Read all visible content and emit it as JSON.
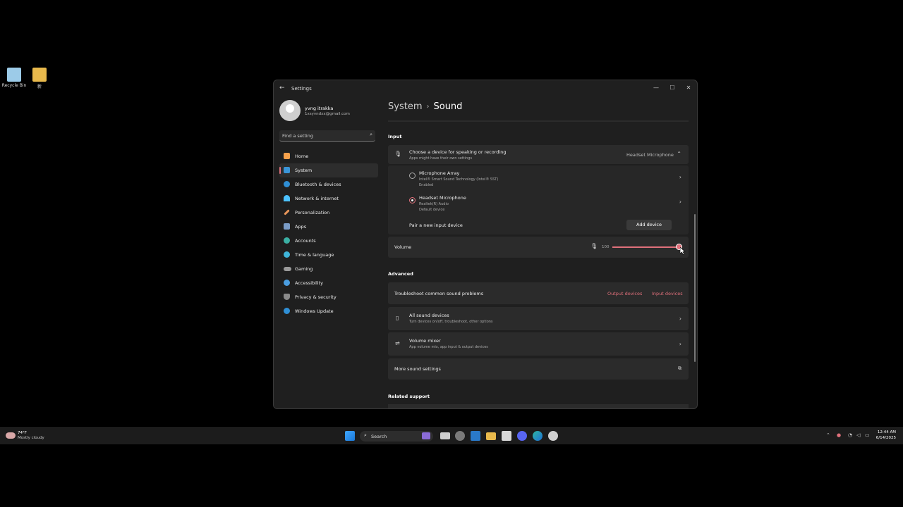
{
  "desktop": {
    "icons": [
      {
        "label": "Recycle Bin"
      },
      {
        "label": "新"
      }
    ]
  },
  "window": {
    "title": "Settings",
    "back_glyph": "←",
    "minimize_glyph": "—",
    "maximize_glyph": "☐",
    "close_glyph": "✕"
  },
  "profile": {
    "name": "yvng itrakka",
    "email": "1xsyvndxx@gmail.com"
  },
  "search": {
    "placeholder": "Find a setting",
    "icon_glyph": "⌕"
  },
  "nav": {
    "items": [
      {
        "label": "Home",
        "icon": "home-icon",
        "color": "#f6a14b"
      },
      {
        "label": "System",
        "icon": "system-icon",
        "color": "#3a95d8"
      },
      {
        "label": "Bluetooth & devices",
        "icon": "bluetooth-icon",
        "color": "#2f8fd5"
      },
      {
        "label": "Network & internet",
        "icon": "network-icon",
        "color": "#4cc2ff"
      },
      {
        "label": "Personalization",
        "icon": "brush-icon",
        "color": "#e8965a"
      },
      {
        "label": "Apps",
        "icon": "apps-icon",
        "color": "#7a9cc6"
      },
      {
        "label": "Accounts",
        "icon": "accounts-icon",
        "color": "#3bb0a4"
      },
      {
        "label": "Time & language",
        "icon": "globe-icon",
        "color": "#3fb5d9"
      },
      {
        "label": "Gaming",
        "icon": "gaming-icon",
        "color": "#9a9a9a"
      },
      {
        "label": "Accessibility",
        "icon": "accessibility-icon",
        "color": "#4a9de0"
      },
      {
        "label": "Privacy & security",
        "icon": "shield-icon",
        "color": "#8a8a8a"
      },
      {
        "label": "Windows Update",
        "icon": "update-icon",
        "color": "#2f8fd5"
      }
    ],
    "active_index": 1
  },
  "breadcrumb": {
    "parent": "System",
    "separator": "›",
    "current": "Sound"
  },
  "input_section": {
    "heading": "Input",
    "choose": {
      "title": "Choose a device for speaking or recording",
      "subtitle": "Apps might have their own settings",
      "selected": "Headset Microphone",
      "chevron": "⌃"
    },
    "devices": [
      {
        "name": "Microphone Array",
        "line1": "Intel® Smart Sound Technology (Intel® SST)",
        "line2": "Enabled",
        "selected": false
      },
      {
        "name": "Headset Microphone",
        "line1": "Realtek(R) Audio",
        "line2": "Default device",
        "selected": true
      }
    ],
    "pair": {
      "label": "Pair a new input device",
      "button": "Add device"
    },
    "volume": {
      "label": "Volume",
      "value": "100",
      "level": 1.0
    }
  },
  "advanced_section": {
    "heading": "Advanced",
    "troubleshoot": {
      "label": "Troubleshoot common sound problems",
      "link1": "Output devices",
      "link2": "Input devices"
    },
    "all_devices": {
      "title": "All sound devices",
      "subtitle": "Turn devices on/off, troubleshoot, other options"
    },
    "mixer": {
      "title": "Volume mixer",
      "subtitle": "App volume mix, app input & output devices"
    },
    "more": {
      "label": "More sound settings",
      "icon_glyph": "⧉"
    }
  },
  "related": {
    "heading": "Related support"
  },
  "taskbar": {
    "weather_temp": "74°F",
    "weather_desc": "Mostly cloudy",
    "search_placeholder": "Search",
    "time": "12:44 AM",
    "date": "6/14/2025"
  },
  "colors": {
    "accent": "#e0707b",
    "window_bg": "#1f1f1f",
    "card_bg": "#2b2b2b"
  }
}
